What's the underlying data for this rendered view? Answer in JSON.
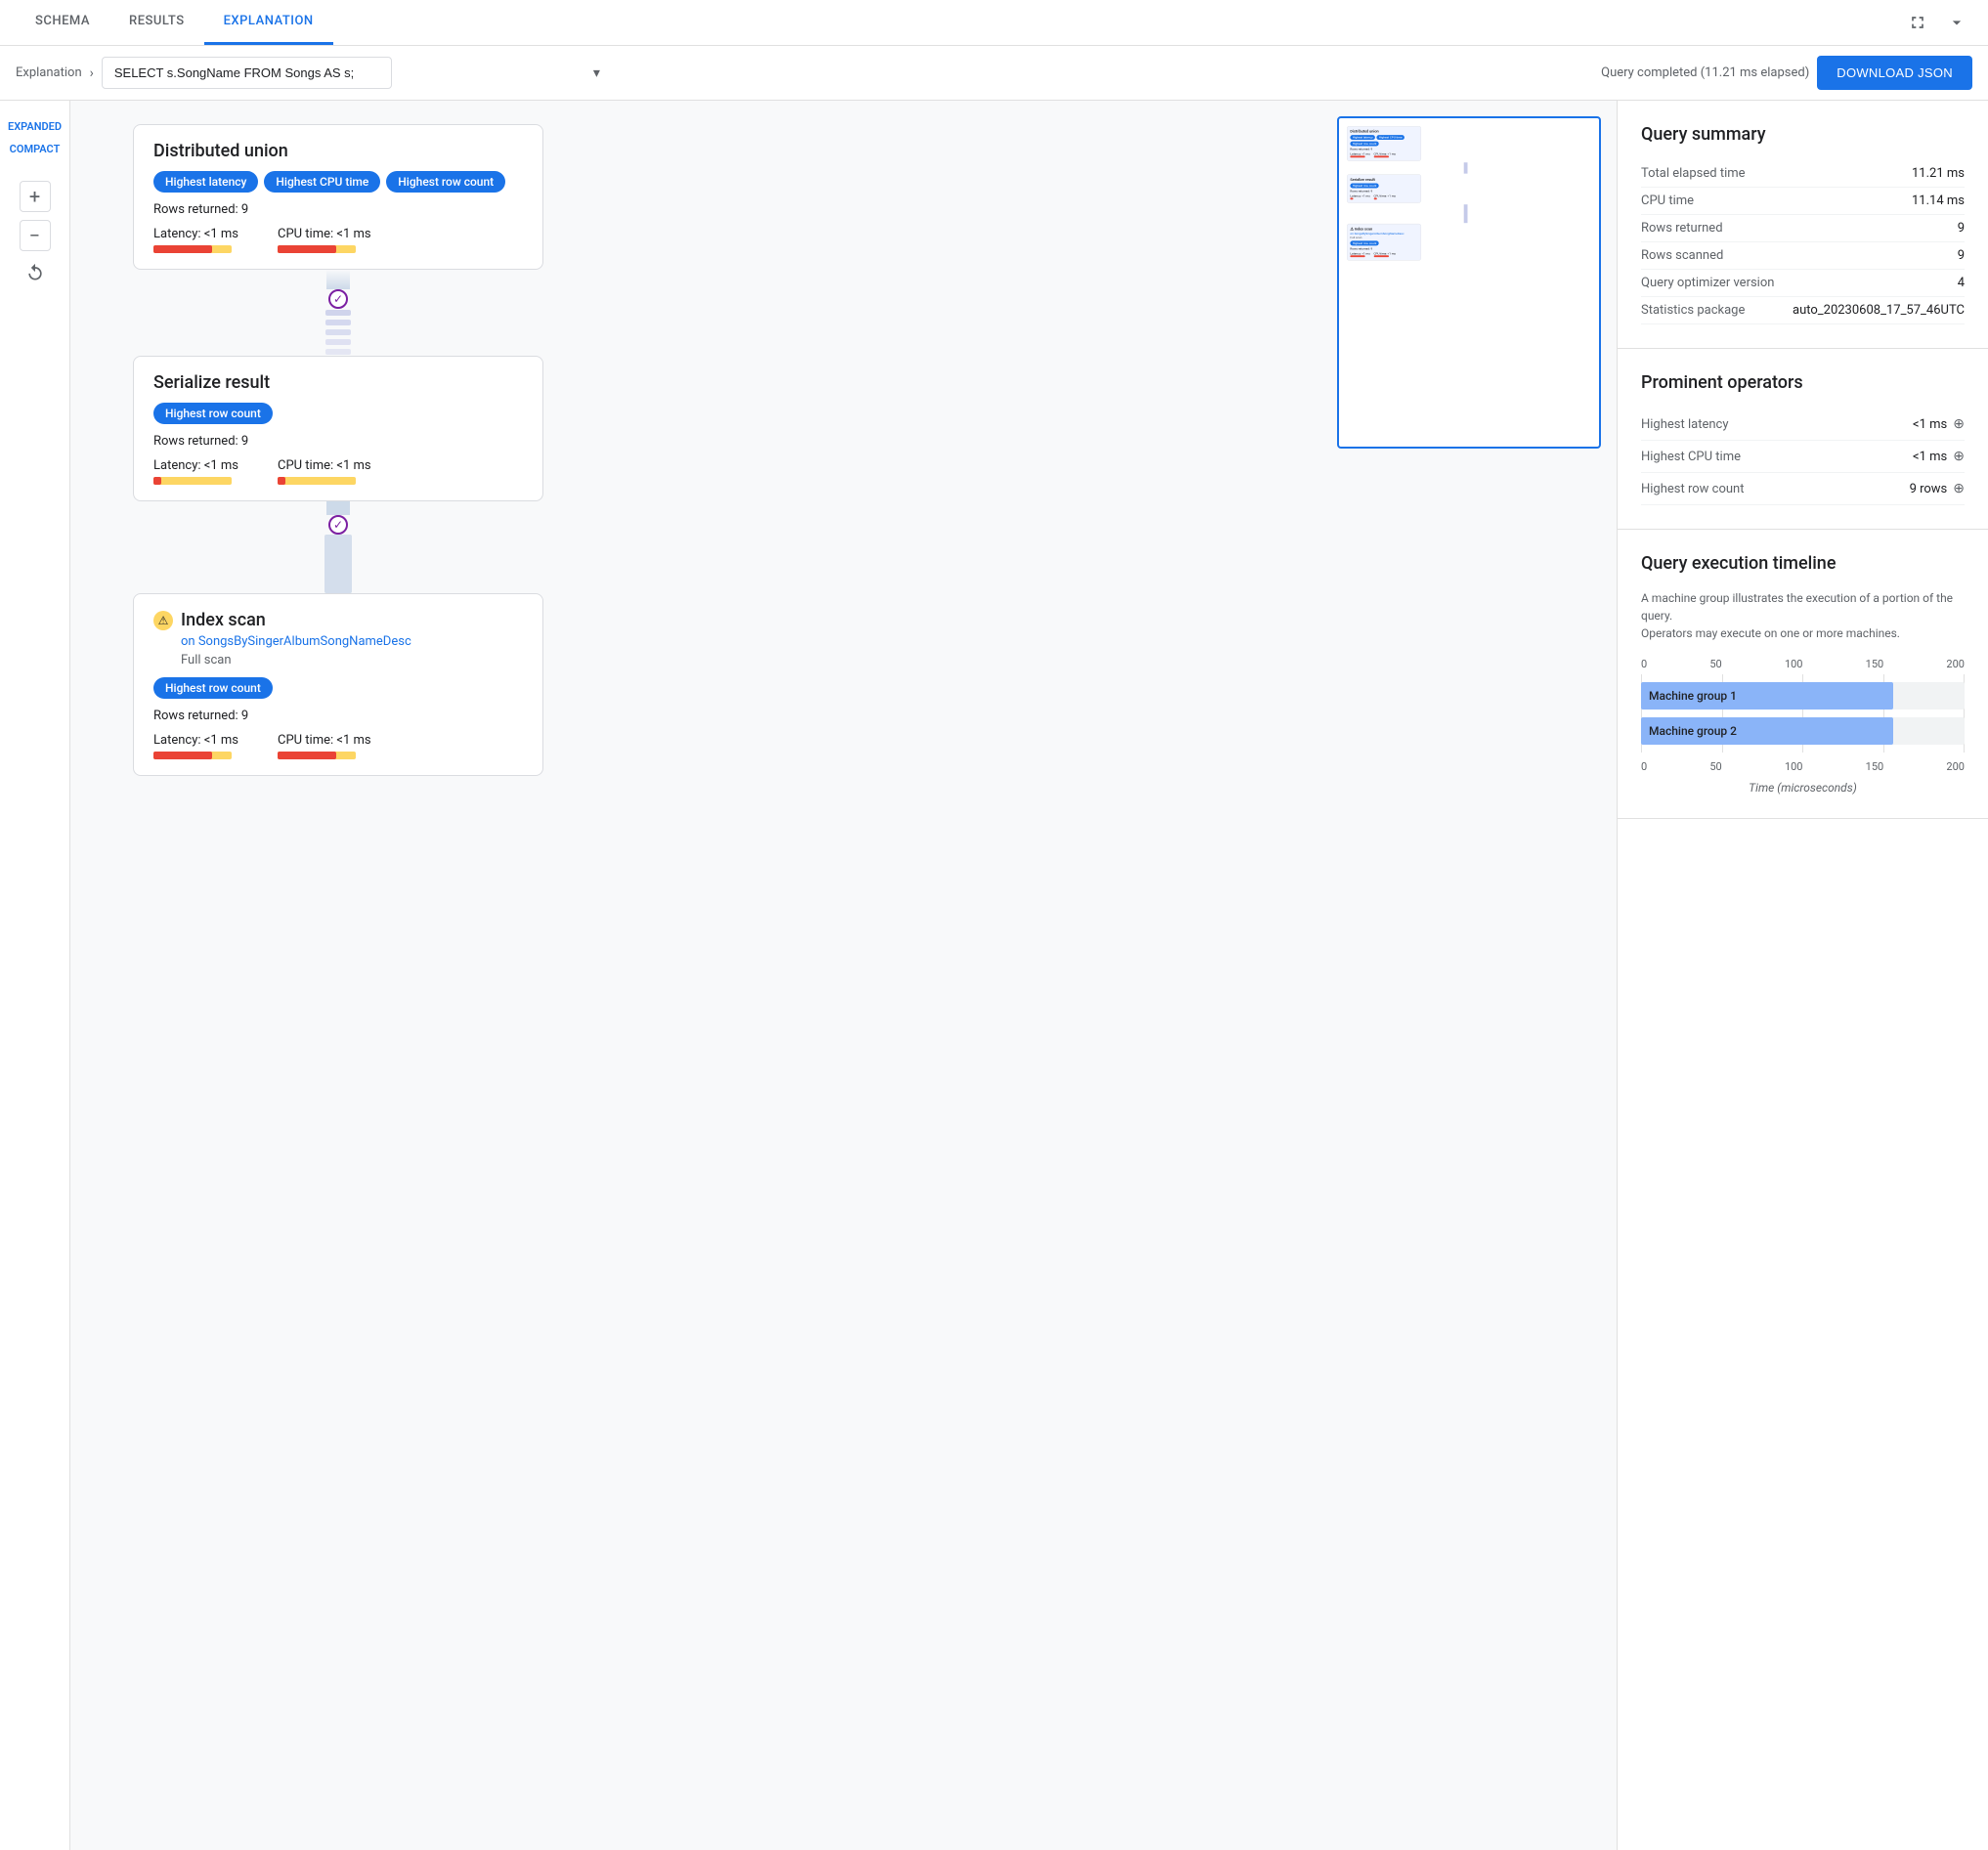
{
  "tabs": [
    {
      "label": "SCHEMA",
      "active": false
    },
    {
      "label": "RESULTS",
      "active": false
    },
    {
      "label": "EXPLANATION",
      "active": true
    }
  ],
  "header": {
    "query": "SELECT s.SongName FROM Songs AS s;",
    "query_status": "Query completed (11.21 ms elapsed)",
    "download_btn": "DOWNLOAD JSON",
    "breadcrumb_label": "Explanation",
    "expanded_label": "EXPANDED",
    "compact_label": "COMPACT"
  },
  "nodes": [
    {
      "id": "distributed-union",
      "title": "Distributed union",
      "badges": [
        "Highest latency",
        "Highest CPU time",
        "Highest row count"
      ],
      "rows_returned": "Rows returned: 9",
      "latency": "Latency: <1 ms",
      "cpu_time": "CPU time: <1 ms",
      "bar_width_latency": 60,
      "bar_width_cpu": 60
    },
    {
      "id": "serialize-result",
      "title": "Serialize result",
      "badges": [
        "Highest row count"
      ],
      "rows_returned": "Rows returned: 9",
      "latency": "Latency: <1 ms",
      "cpu_time": "CPU time: <1 ms",
      "bar_width_latency": 8,
      "bar_width_cpu": 8
    },
    {
      "id": "index-scan",
      "title": "Index scan",
      "warning": true,
      "subtitle": "on SongsBySingerAlbumSongNameDesc",
      "full_scan": "Full scan",
      "badges": [
        "Highest row count"
      ],
      "rows_returned": "Rows returned: 9",
      "latency": "Latency: <1 ms",
      "cpu_time": "CPU time: <1 ms",
      "bar_width_latency": 60,
      "bar_width_cpu": 60
    }
  ],
  "query_summary": {
    "title": "Query summary",
    "rows": [
      {
        "key": "Total elapsed time",
        "value": "11.21 ms"
      },
      {
        "key": "CPU time",
        "value": "11.14 ms"
      },
      {
        "key": "Rows returned",
        "value": "9"
      },
      {
        "key": "Rows scanned",
        "value": "9"
      },
      {
        "key": "Query optimizer version",
        "value": "4"
      },
      {
        "key": "Statistics package",
        "value": "auto_20230608_17_57_46UTC"
      }
    ]
  },
  "prominent_operators": {
    "title": "Prominent operators",
    "rows": [
      {
        "key": "Highest latency",
        "value": "<1 ms"
      },
      {
        "key": "Highest CPU time",
        "value": "<1 ms"
      },
      {
        "key": "Highest row count",
        "value": "9 rows"
      }
    ]
  },
  "timeline": {
    "title": "Query execution timeline",
    "description_line1": "A machine group illustrates the execution of a portion of the query.",
    "description_line2": "Operators may execute on one or more machines.",
    "axis_labels": [
      "0",
      "50",
      "100",
      "150",
      "200"
    ],
    "bars": [
      {
        "label": "Machine group 1",
        "width_pct": 78,
        "value": ""
      },
      {
        "label": "Machine group 2",
        "width_pct": 78,
        "value": ""
      }
    ],
    "x_label": "Time (microseconds)"
  }
}
